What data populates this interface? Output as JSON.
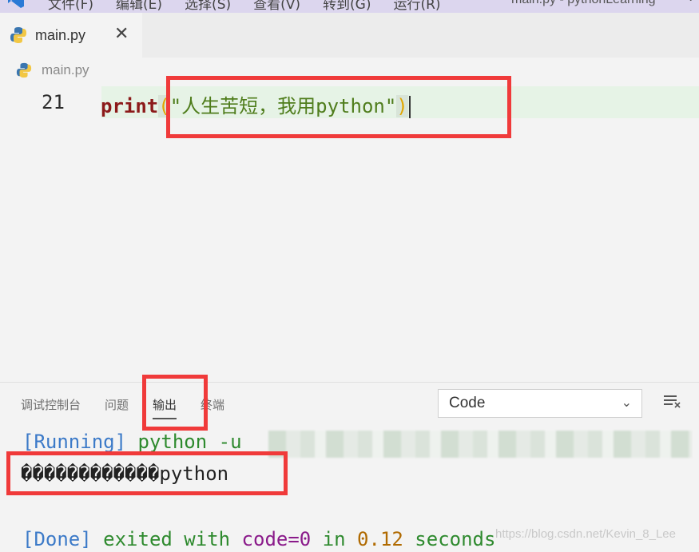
{
  "titlebar": {
    "menu": [
      "文件(F)",
      "编辑(E)",
      "选择(S)",
      "查看(V)",
      "转到(G)",
      "运行(R)"
    ],
    "window_title": "main.py - pythonLearning",
    "chevron": "˅"
  },
  "tab": {
    "label": "main.py",
    "close": "✕"
  },
  "breadcrumb": {
    "label": "main.py"
  },
  "editor": {
    "line_number": "21",
    "code": {
      "fn": "print",
      "open_paren": "(",
      "string": "\"人生苦短，我用python\"",
      "close_paren": ")"
    }
  },
  "panel": {
    "tabs": [
      "调试控制台",
      "问题",
      "输出",
      "终端"
    ],
    "select_value": "Code",
    "select_chevron": "⌄",
    "output": {
      "running_tag": "[Running]",
      "running_cmd": " python -u ",
      "garbled": "������������",
      "garbled_tail": "python",
      "done_tag": "[Done]",
      "done_word1": " exited with ",
      "done_code": "code=0",
      "done_in": " in ",
      "done_time": "0.12",
      "done_seconds": " seconds"
    }
  },
  "watermark": "https://blog.csdn.net/Kevin_8_Lee",
  "colors": {
    "annotation_red": "#f03a3a",
    "titlebar": "#dcd6ee",
    "string_green": "#4f7d1c",
    "keyword_red": "#8c1a1a"
  }
}
